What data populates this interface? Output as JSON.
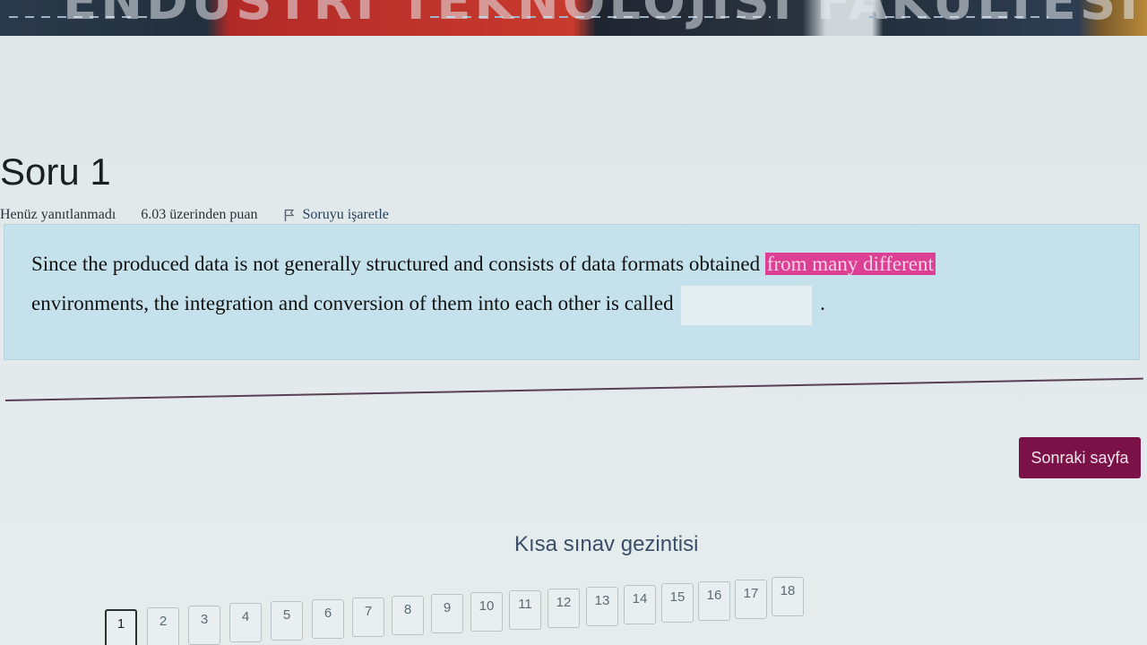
{
  "banner": {
    "text": "ENDÜSTRİ TEKNOLOJİSİ FAKÜLTESİ"
  },
  "question": {
    "title": "Soru 1",
    "status": "Henüz yanıtlanmadı",
    "points": "6.03 üzerinden puan",
    "flag_label": "Soruyu işaretle",
    "text_line1": "Since the produced data is not generally structured and consists of data formats obtained",
    "highlight": "from many different",
    "text_line2": "environments, the integration and conversion of them into each other is called",
    "answer_value": "",
    "end_punct": "."
  },
  "actions": {
    "next_label": "Sonraki sayfa"
  },
  "quiz_nav": {
    "title": "Kısa sınav gezintisi",
    "current": "1",
    "items": [
      "1",
      "2",
      "3",
      "4",
      "5",
      "6",
      "7",
      "8",
      "9",
      "10",
      "11",
      "12",
      "13",
      "14",
      "15",
      "16",
      "17",
      "18"
    ]
  },
  "colors": {
    "question_bg": "#c5e2ec",
    "highlight_bg": "#dc3f94",
    "next_button": "#7a1248"
  }
}
